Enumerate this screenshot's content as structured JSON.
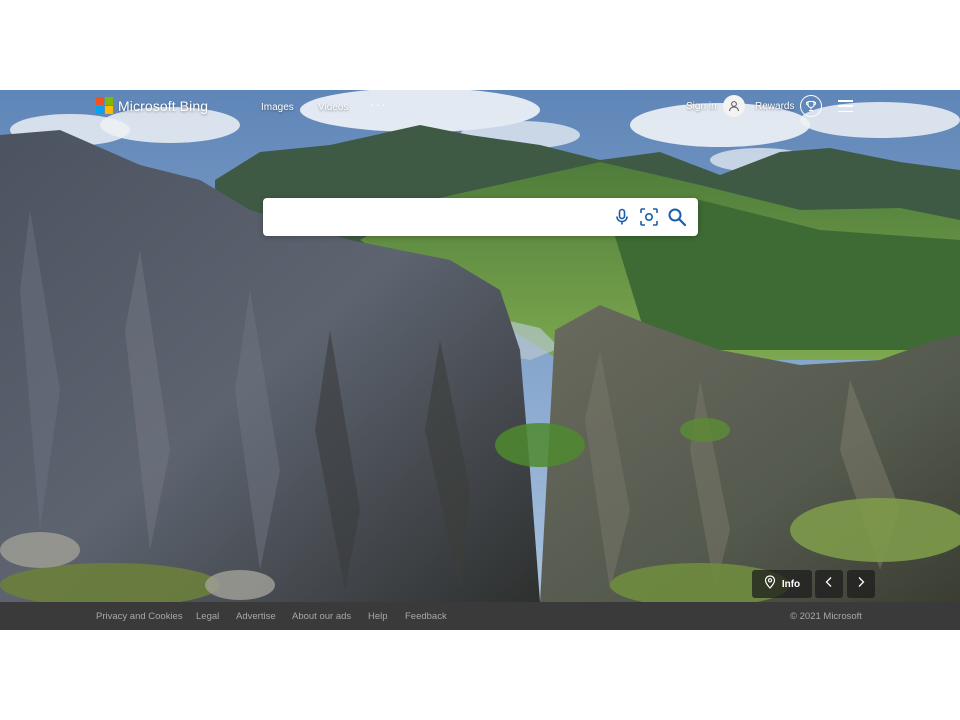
{
  "brand": {
    "name": "Microsoft Bing",
    "logo_colors": [
      "#f25022",
      "#7fba00",
      "#00a4ef",
      "#ffb900"
    ]
  },
  "header": {
    "nav": [
      {
        "label": "Images"
      },
      {
        "label": "Videos"
      }
    ],
    "more_label": "···",
    "signin_label": "Sign in",
    "rewards_label": "Rewards"
  },
  "search": {
    "value": "",
    "placeholder": "",
    "icons": [
      "microphone-icon",
      "visual-search-icon",
      "search-icon"
    ]
  },
  "image_controls": {
    "info_label": "Info",
    "icons": [
      "location-pin-icon",
      "chevron-left-icon",
      "chevron-right-icon"
    ]
  },
  "footer": {
    "links": [
      {
        "label": "Privacy and Cookies"
      },
      {
        "label": "Legal"
      },
      {
        "label": "Advertise"
      },
      {
        "label": "About our ads"
      },
      {
        "label": "Help"
      },
      {
        "label": "Feedback"
      }
    ],
    "copyright": "© 2021 Microsoft"
  },
  "colors": {
    "footer_bg": "#3a3a3a",
    "footer_text": "#a8a8a8",
    "overlay_button_bg": "#1e1e1e"
  }
}
